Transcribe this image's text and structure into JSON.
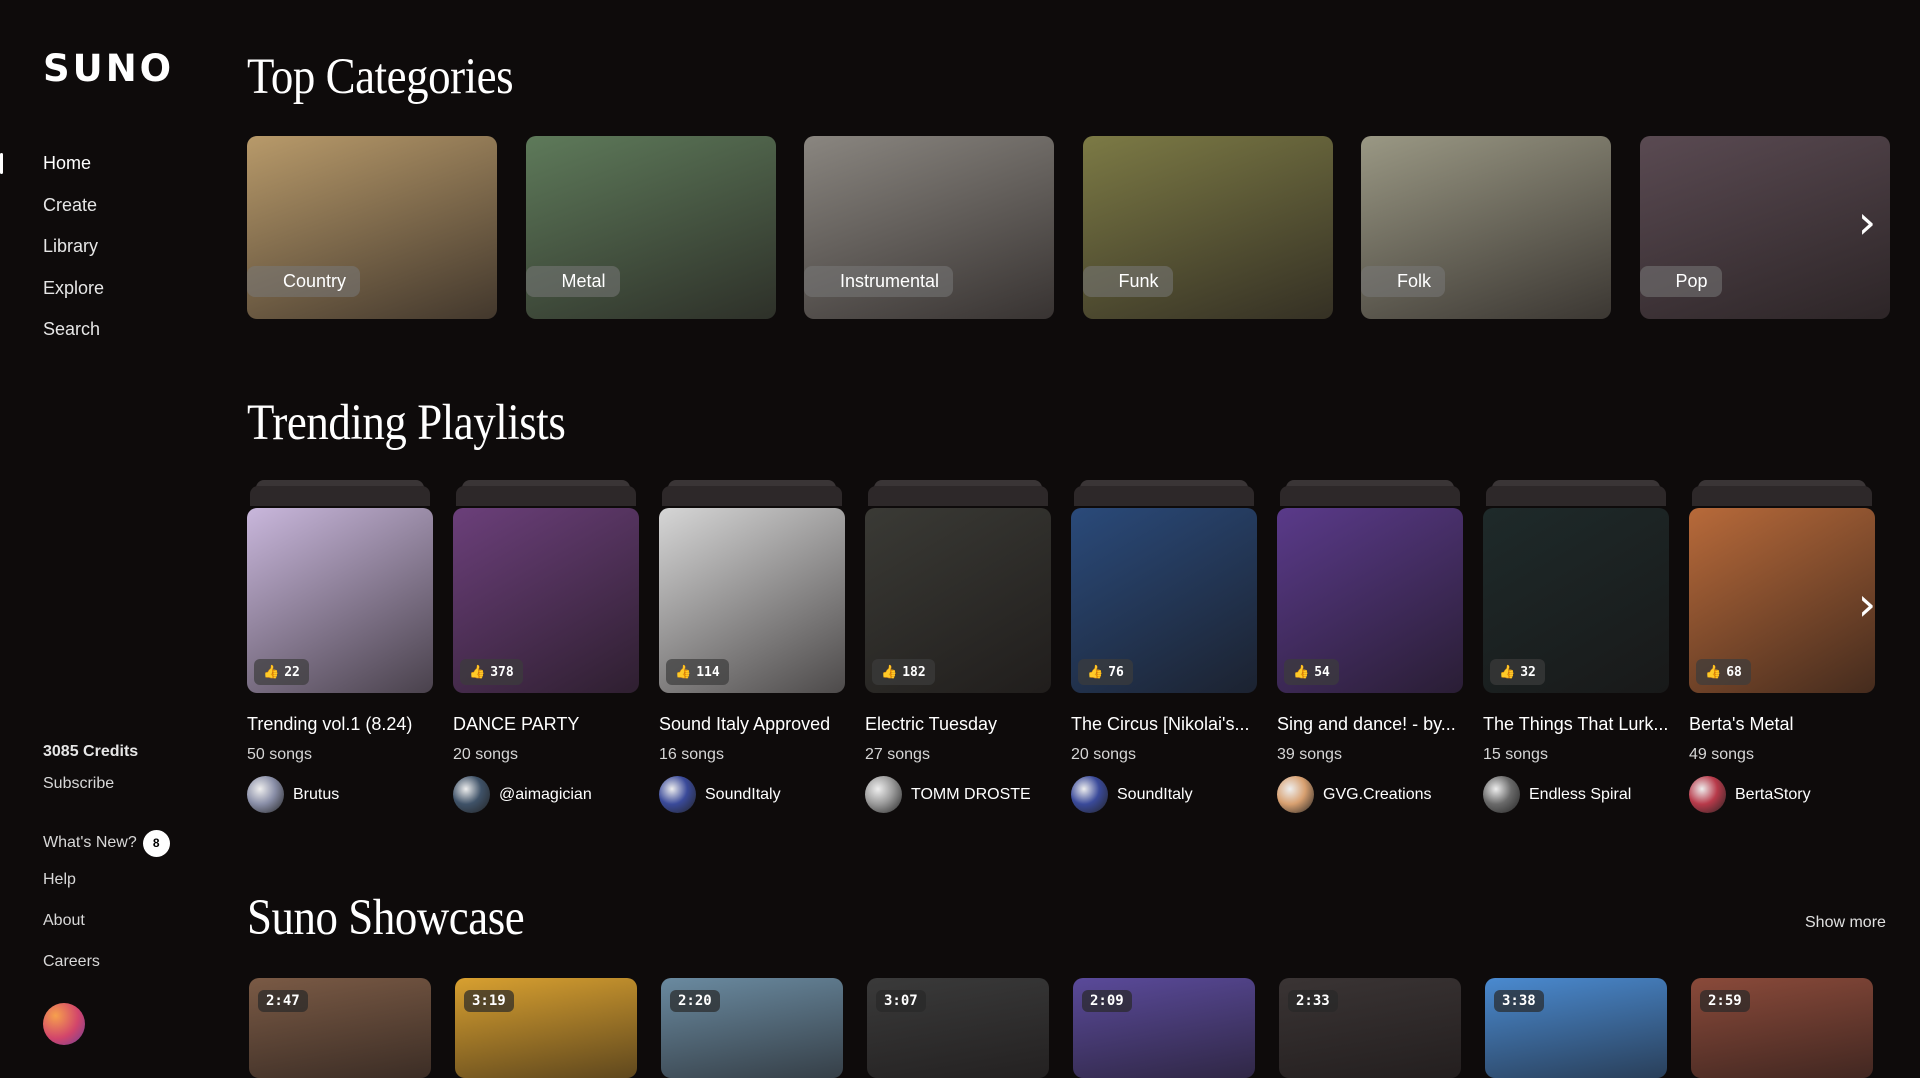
{
  "app": {
    "logo": "SUNO"
  },
  "nav": [
    {
      "label": "Home",
      "active": true
    },
    {
      "label": "Create"
    },
    {
      "label": "Library"
    },
    {
      "label": "Explore"
    },
    {
      "label": "Search"
    }
  ],
  "sidebar_bottom": {
    "credits": "3085 Credits",
    "subscribe": "Subscribe",
    "whats_new": "What's New?",
    "whats_new_count": "8",
    "help": "Help",
    "about": "About",
    "careers": "Careers"
  },
  "sections": {
    "categories": "Top Categories",
    "playlists": "Trending Playlists",
    "showcase": "Suno Showcase",
    "show_more": "Show more"
  },
  "categories": [
    {
      "label": "Country",
      "color": "#b89a6a"
    },
    {
      "label": "Metal",
      "color": "#5e7a5a"
    },
    {
      "label": "Instrumental",
      "color": "#8a8680"
    },
    {
      "label": "Funk",
      "color": "#7c7a45"
    },
    {
      "label": "Folk",
      "color": "#9a9884"
    },
    {
      "label": "Pop",
      "color": "#5a4a52"
    }
  ],
  "playlists": [
    {
      "title": "Trending vol.1 (8.24)",
      "songs": "50 songs",
      "likes": "22",
      "author": "Brutus",
      "art": "#c9b7dc",
      "avatar": "#8a8fa8"
    },
    {
      "title": "DANCE PARTY",
      "songs": "20 songs",
      "likes": "378",
      "author": "@aimagician",
      "art": "#6b3f7a",
      "avatar": "#3f5268"
    },
    {
      "title": "Sound Italy Approved",
      "songs": "16 songs",
      "likes": "114",
      "author": "SoundItaly",
      "art": "#d6d6d6",
      "avatar": "#3a4a9a"
    },
    {
      "title": "Electric Tuesday",
      "songs": "27 songs",
      "likes": "182",
      "author": "TOMM DROSTE",
      "art": "#3a3a35",
      "avatar": "#9a9a9a"
    },
    {
      "title": "The Circus [Nikolai's...",
      "songs": "20 songs",
      "likes": "76",
      "author": "SoundItaly",
      "art": "#2a4a7a",
      "avatar": "#3a4a9a"
    },
    {
      "title": "Sing and dance! - by...",
      "songs": "39 songs",
      "likes": "54",
      "author": "GVG.Creations",
      "art": "#5a3a8a",
      "avatar": "#d8a070"
    },
    {
      "title": "The Things That Lurk...",
      "songs": "15 songs",
      "likes": "32",
      "author": "Endless Spiral",
      "art": "#1e2a2a",
      "avatar": "#6a6a6a"
    },
    {
      "title": "Berta's Metal",
      "songs": "49 songs",
      "likes": "68",
      "author": "BertaStory",
      "art": "#b86a3a",
      "avatar": "#b83a4a"
    }
  ],
  "showcase": [
    {
      "duration": "2:47",
      "color": "#7a5a45"
    },
    {
      "duration": "3:19",
      "color": "#d8a030"
    },
    {
      "duration": "2:20",
      "color": "#6a8aa0"
    },
    {
      "duration": "3:07",
      "color": "#3a3a3a"
    },
    {
      "duration": "2:09",
      "color": "#5a4a9a"
    },
    {
      "duration": "2:33",
      "color": "#3a3434"
    },
    {
      "duration": "3:38",
      "color": "#4a8ad0"
    },
    {
      "duration": "2:59",
      "color": "#8a4a3a"
    }
  ]
}
